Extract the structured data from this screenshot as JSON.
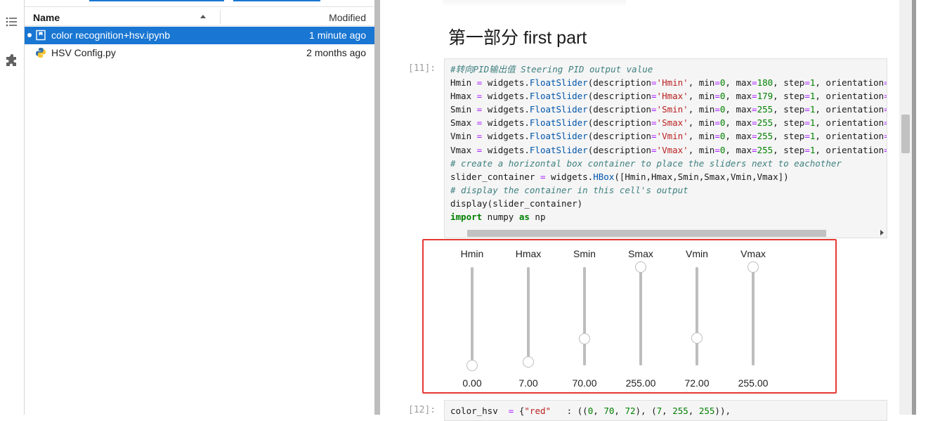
{
  "activity_bar": {
    "icons": [
      "list-icon",
      "puzzle-icon"
    ]
  },
  "file_browser": {
    "columns": {
      "name": "Name",
      "modified": "Modified"
    },
    "files": [
      {
        "name": "color recognition+hsv.ipynb",
        "modified": "1 minute ago",
        "selected": true,
        "running": true,
        "icon": "notebook-icon"
      },
      {
        "name": "HSV Config.py",
        "modified": "2 months ago",
        "selected": false,
        "running": false,
        "icon": "python-icon"
      }
    ]
  },
  "notebook": {
    "heading": "第一部分 first part",
    "cell_11": {
      "prompt": "[11]:"
    },
    "cell_12": {
      "prompt": "[12]:"
    }
  },
  "sliders": [
    {
      "label": "Hmin",
      "value": "0.00",
      "min": 0,
      "max": 180,
      "level": 0.0
    },
    {
      "label": "Hmax",
      "value": "7.00",
      "min": 0,
      "max": 179,
      "level": 0.039
    },
    {
      "label": "Smin",
      "value": "70.00",
      "min": 0,
      "max": 255,
      "level": 0.275
    },
    {
      "label": "Smax",
      "value": "255.00",
      "min": 0,
      "max": 255,
      "level": 1.0
    },
    {
      "label": "Vmin",
      "value": "72.00",
      "min": 0,
      "max": 255,
      "level": 0.282
    },
    {
      "label": "Vmax",
      "value": "255.00",
      "min": 0,
      "max": 255,
      "level": 1.0
    }
  ],
  "colors": {
    "accent": "#1976d2",
    "highlight_box": "#e53935"
  }
}
